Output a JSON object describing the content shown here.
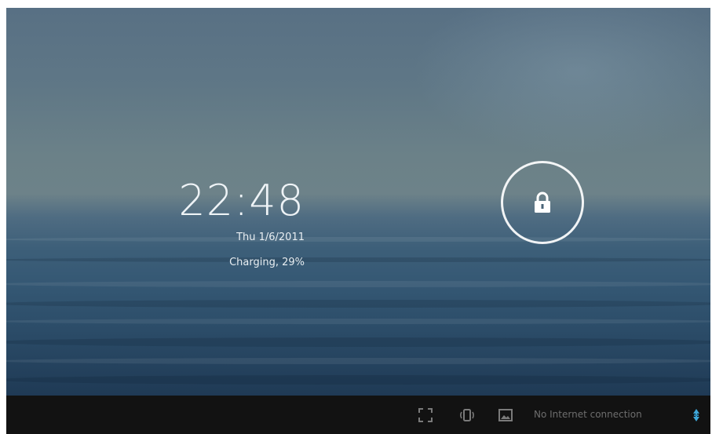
{
  "lockscreen": {
    "time": "22:48",
    "date": "Thu 1/6/2011",
    "battery_status": "Charging, 29%"
  },
  "unlock": {
    "icon": "lock-icon"
  },
  "statusbar": {
    "icons": [
      "fullscreen-icon",
      "screen-rotation-icon",
      "gallery-icon"
    ],
    "network_status": "No Internet connection",
    "network_icon": "data-connection-icon"
  },
  "colors": {
    "accent": "#ffffff",
    "navbar": "#121212",
    "status_text": "#6e6e6e"
  }
}
